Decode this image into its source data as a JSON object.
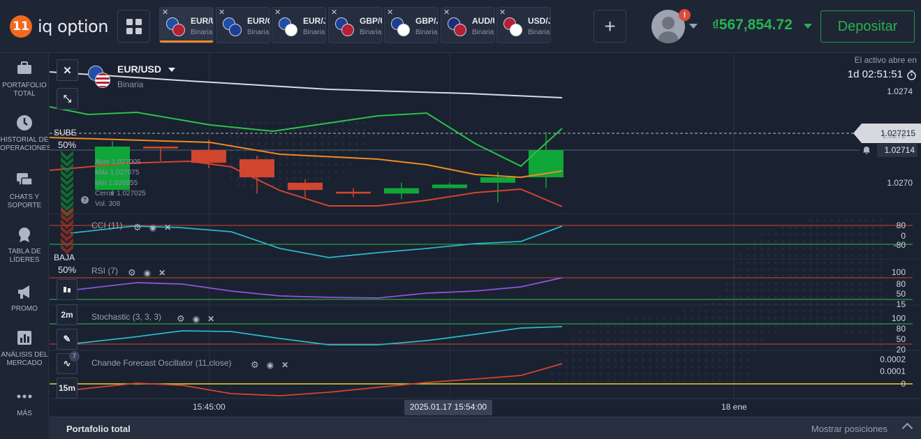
{
  "brand": {
    "logo_number": "11",
    "name": "iq option"
  },
  "tabs": [
    {
      "symbol": "EUR/U",
      "type": "Binaria",
      "flag1": "#1f4fa8",
      "flag2": "#b22234",
      "active": true
    },
    {
      "symbol": "EUR/G",
      "type": "Binaria",
      "flag1": "#1f4fa8",
      "flag2": "#1c3f94",
      "active": false
    },
    {
      "symbol": "EUR/J",
      "type": "Binaria",
      "flag1": "#1f4fa8",
      "flag2": "#ffffff",
      "active": false
    },
    {
      "symbol": "GBP/U",
      "type": "Binaria",
      "flag1": "#1c3f94",
      "flag2": "#b22234",
      "active": false
    },
    {
      "symbol": "GBP/J",
      "type": "Binaria",
      "flag1": "#1c3f94",
      "flag2": "#ffffff",
      "active": false
    },
    {
      "symbol": "AUD/U",
      "type": "Binaria",
      "flag1": "#1a2e7a",
      "flag2": "#b22234",
      "active": false
    },
    {
      "symbol": "USD/JPY",
      "type": "Binaria",
      "flag1": "#b22234",
      "flag2": "#ffffff",
      "active": false
    }
  ],
  "header": {
    "notification_badge": "!",
    "balance": "567,854.72",
    "deposit_label": "Depositar"
  },
  "sidebar": {
    "items": [
      {
        "label": "PORTAFOLIO TOTAL",
        "icon": "briefcase-icon"
      },
      {
        "label": "HISTORIAL DE OPERACIONES",
        "icon": "clock-icon"
      },
      {
        "label": "CHATS Y SOPORTE",
        "icon": "chat-icon"
      },
      {
        "label": "TABLA DE LÍDERES",
        "icon": "trophy-icon"
      },
      {
        "label": "PROMO",
        "icon": "megaphone-icon"
      },
      {
        "label": "ANÁLISIS DEL MERCADO",
        "icon": "analysis-icon"
      },
      {
        "label": "MÁS",
        "icon": "more-icon"
      }
    ]
  },
  "asset": {
    "name": "EUR/USD",
    "type": "Binaria"
  },
  "sentiment": {
    "up_label": "SUBE",
    "up_pct": "50%",
    "down_label": "BAJA",
    "down_pct": "50%"
  },
  "tools": {
    "timeframe": "2m",
    "expiry": "15m",
    "indicator_count": "7"
  },
  "ohlc": {
    "open": "Abrir   1.027005",
    "high": "Máx   1.027075",
    "low": "Mín   1.026955",
    "close": "Cerrar  1.027025",
    "vol": "Vol.   308"
  },
  "asset_open": {
    "label": "El activo abre en",
    "time": "1d 02:51:51"
  },
  "price_axis": {
    "p1": "1.0274",
    "p2": "1.0270",
    "current": "1.027215",
    "current_shadow": "1.0272",
    "alert": "1.02714"
  },
  "indicators": [
    {
      "label": "CCI (11)",
      "levels": [
        "80",
        "0",
        "-80"
      ]
    },
    {
      "label": "RSI (7)",
      "levels": [
        "100",
        "80",
        "50",
        "15"
      ]
    },
    {
      "label": "Stochastic (3, 3, 3)",
      "levels": [
        "100",
        "80",
        "50",
        "20"
      ]
    },
    {
      "label": "Chande Forecast Oscillator (11,close)",
      "levels": [
        "0.0002",
        "0.0001",
        "0"
      ]
    }
  ],
  "time_axis": {
    "t1": "15:45:00",
    "cursor": "2025.01.17 15:54:00",
    "t2": "18 ene"
  },
  "bottom": {
    "portfolio": "Portafolio total",
    "show_positions": "Mostrar posiciones"
  },
  "colors": {
    "up": "#0fa63a",
    "down": "#d2452f",
    "accent": "#f08a24",
    "green_text": "#27b34f"
  },
  "chart_data": {
    "type": "candlestick",
    "candles": [
      {
        "o": 1.02699,
        "c": 1.02723,
        "h": 1.02726,
        "l": 1.02696
      },
      {
        "o": 1.02723,
        "c": 1.02722,
        "h": 1.02723,
        "l": 1.02715
      },
      {
        "o": 1.02721,
        "c": 1.02714,
        "h": 1.02727,
        "l": 1.02711
      },
      {
        "o": 1.02716,
        "c": 1.02706,
        "h": 1.02718,
        "l": 1.02697
      },
      {
        "o": 1.02703,
        "c": 1.02699,
        "h": 1.02705,
        "l": 1.02695
      },
      {
        "o": 1.02698,
        "c": 1.02697,
        "h": 1.027,
        "l": 1.02695
      },
      {
        "o": 1.02697,
        "c": 1.027,
        "h": 1.02703,
        "l": 1.02694
      },
      {
        "o": 1.027,
        "c": 1.02702,
        "h": 1.02703,
        "l": 1.027
      },
      {
        "o": 1.02703,
        "c": 1.02706,
        "h": 1.02709,
        "l": 1.02692
      },
      {
        "o": 1.02706,
        "c": 1.02721,
        "h": 1.02731,
        "l": 1.027
      }
    ],
    "ylim": [
      1.02684,
      1.02757
    ]
  }
}
